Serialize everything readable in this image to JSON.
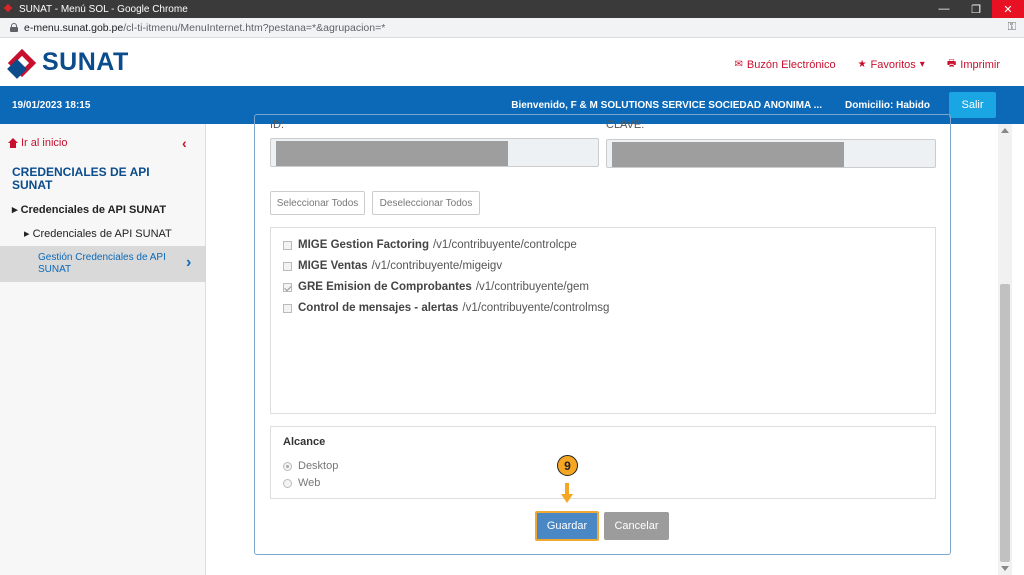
{
  "window": {
    "title": "SUNAT - Menú SOL - Google Chrome",
    "controls": {
      "minimize": "—",
      "maximize": "❐",
      "close": "✕"
    }
  },
  "address": {
    "host": "e-menu.sunat.gob.pe",
    "path": "/cl-ti-itmenu/MenuInternet.htm?pestana=*&agrupacion=*",
    "key_icon": "key-icon"
  },
  "header": {
    "logo_text": "SUNAT",
    "links": {
      "buzon": "Buzón Electrónico",
      "favoritos": "Favoritos",
      "imprimir": "Imprimir"
    }
  },
  "bluebar": {
    "date": "19/01/2023 18:15",
    "welcome": "Bienvenido, F & M SOLUTIONS SERVICE SOCIEDAD ANONIMA ...",
    "domicilio": "Domicilio: Habido",
    "salir": "Salir"
  },
  "sidebar": {
    "home": "Ir al inicio",
    "section_title": "CREDENCIALES DE API SUNAT",
    "level1": "Credenciales de API SUNAT",
    "level2": "Credenciales de API SUNAT",
    "active_item": "Gestión Credenciales de API SUNAT"
  },
  "form": {
    "id_label": "ID:",
    "clave_label": "CLAVE:",
    "select_all": "Seleccionar Todos",
    "deselect_all": "Deseleccionar Todos",
    "scopes": [
      {
        "name": "MIGE Gestion Factoring",
        "path": "/v1/contribuyente/controlcpe",
        "checked": false
      },
      {
        "name": "MIGE Ventas",
        "path": "/v1/contribuyente/migeigv",
        "checked": false
      },
      {
        "name": "GRE Emision de Comprobantes",
        "path": "/v1/contribuyente/gem",
        "checked": true
      },
      {
        "name": "Control de mensajes - alertas",
        "path": "/v1/contribuyente/controlmsg",
        "checked": false
      }
    ],
    "alcance": {
      "title": "Alcance",
      "options": [
        {
          "label": "Desktop",
          "selected": true
        },
        {
          "label": "Web",
          "selected": false
        }
      ]
    },
    "step_number": "9",
    "save": "Guardar",
    "cancel": "Cancelar"
  },
  "colors": {
    "brand_red": "#c8102e",
    "brand_blue": "#0b69b7",
    "salir": "#19a6e3",
    "highlight": "#f5a623"
  }
}
